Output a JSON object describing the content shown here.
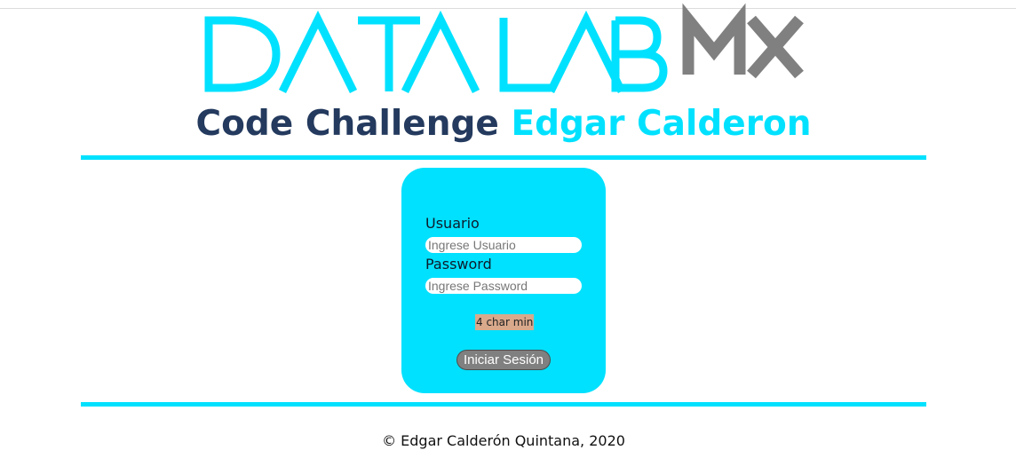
{
  "logo": {
    "text": "DATA LAB",
    "suffix": "MX",
    "colors": {
      "primary": "#00e1ff",
      "suffix": "#808080"
    }
  },
  "headline": {
    "part1": "Code Challenge",
    "part2": "Edgar Calderon",
    "colors": {
      "part1": "#243a5e",
      "part2": "#00e1ff"
    }
  },
  "login": {
    "username_label": "Usuario",
    "username_placeholder": "Ingrese Usuario",
    "username_value": "",
    "password_label": "Password",
    "password_placeholder": "Ingrese Password",
    "password_value": "",
    "hint": "4 char min",
    "submit_label": "Iniciar Sesión"
  },
  "footer": {
    "copyright": "© Edgar Calderón Quintana, 2020"
  },
  "theme": {
    "accent": "#00e1ff",
    "button": "#808080",
    "hint_bg": "#d9a98c"
  }
}
